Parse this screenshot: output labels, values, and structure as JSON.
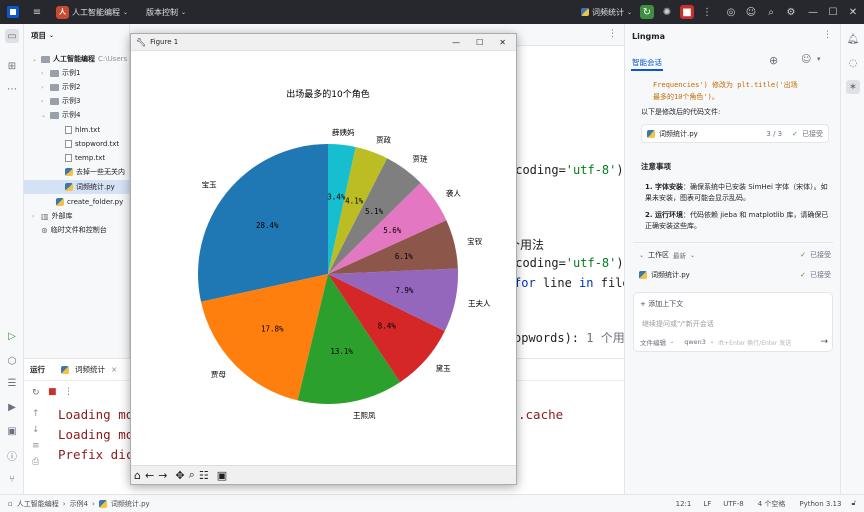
{
  "titlebar": {
    "project_badge": "人",
    "project_name": "人工智能编程",
    "vcs": "版本控制",
    "run_config": "词频统计"
  },
  "project_panel": {
    "title": "项目",
    "items": [
      {
        "label": "人工智能编程",
        "extra": "C:\\Users",
        "type": "root"
      },
      {
        "label": "示例1",
        "type": "folder"
      },
      {
        "label": "示例2",
        "type": "folder"
      },
      {
        "label": "示例3",
        "type": "folder"
      },
      {
        "label": "示例4",
        "type": "folder"
      },
      {
        "label": "hlm.txt",
        "type": "txt"
      },
      {
        "label": "stopword.txt",
        "type": "txt"
      },
      {
        "label": "temp.txt",
        "type": "txt"
      },
      {
        "label": "去掉一些无关内",
        "type": "py"
      },
      {
        "label": "词频统计.py",
        "type": "py"
      },
      {
        "label": "create_folder.py",
        "type": "py"
      },
      {
        "label": "外部库",
        "type": "lib"
      },
      {
        "label": "临时文件和控制台",
        "type": "lib"
      }
    ]
  },
  "editor": {
    "line1_pre": "ncoding=",
    "line1_str": "'utf-8'",
    "line1_post": ")",
    "line2": "个用法",
    "line3_pre": "ncoding=",
    "line3_str": "'utf-8'",
    "line3_post": ")",
    "line4_kw1": "for",
    "line4_mid": " line ",
    "line4_kw2": "in",
    "line4_post": " file",
    "line5": "opwords):",
    "line5_hint": "1 个用"
  },
  "run_panel": {
    "tab_run": "运行",
    "tab_config": "词频统计",
    "console": [
      "Loading mo",
      "Loading mo",
      "Prefix dic"
    ],
    "console_tail": ".cache"
  },
  "lingma": {
    "title": "Lingma",
    "tab": "智能会话",
    "code_line1": "Frequencies') 修改为 plt.title('出场",
    "code_line2": "最多的10个角色')。",
    "desc": "以下是修改后的代码文件:",
    "file_card": {
      "name": "词频统计.py",
      "count": "3 / 3",
      "status": "已接受"
    },
    "notes_title": "注意事项",
    "note1_title": "字体安装",
    "note1": "：确保系统中已安装 SimHei 字体（宋体）。如果未安装，图表可能会显示乱码。",
    "note2_title": "运行环境",
    "note2": "：代码依赖 jieba 和 matplotlib 库，请确保已正确安装这些库。",
    "workspace_label": "工作区",
    "workspace_latest": "最新",
    "workspace_status": "已接受",
    "workspace_file": "词频统计.py",
    "workspace_file_status": "已接受",
    "add_context": "添加上下文",
    "input_placeholder": "继续提问或\"/\"新开会话",
    "footer_mode": "文件编辑",
    "footer_model": "qwen3",
    "footer_hint": "ift+Enter 换行/Enter 发送"
  },
  "statusbar": {
    "crumb1": "人工智能编程",
    "crumb2": "示例4",
    "crumb3": "词频统计.py",
    "position": "12:1",
    "line_sep": "LF",
    "encoding": "UTF-8",
    "indent": "4 个空格",
    "python": "Python 3.13"
  },
  "figure": {
    "window_title": "Figure 1"
  },
  "chart_data": {
    "type": "pie",
    "title": "出场最多的10个角色",
    "slices": [
      {
        "label": "宝玉",
        "value": 28.4,
        "pct": "28.4%",
        "color": "#1f77b4"
      },
      {
        "label": "贾母",
        "value": 17.8,
        "pct": "17.8%",
        "color": "#ff7f0e"
      },
      {
        "label": "王熙凤",
        "value": 13.1,
        "pct": "13.1%",
        "color": "#2ca02c"
      },
      {
        "label": "黛玉",
        "value": 8.4,
        "pct": "8.4%",
        "color": "#d62728"
      },
      {
        "label": "王夫人",
        "value": 7.9,
        "pct": "7.9%",
        "color": "#9467bd"
      },
      {
        "label": "宝钗",
        "value": 6.1,
        "pct": "6.1%",
        "color": "#8c564b"
      },
      {
        "label": "袭人",
        "value": 5.6,
        "pct": "5.6%",
        "color": "#e377c2"
      },
      {
        "label": "贾琏",
        "value": 5.1,
        "pct": "5.1%",
        "color": "#7f7f7f"
      },
      {
        "label": "贾政",
        "value": 4.1,
        "pct": "4.1%",
        "color": "#bcbd22"
      },
      {
        "label": "薛姨妈",
        "value": 3.4,
        "pct": "3.4%",
        "color": "#17becf"
      }
    ],
    "start_angle": 90,
    "direction": "counterclockwise"
  }
}
